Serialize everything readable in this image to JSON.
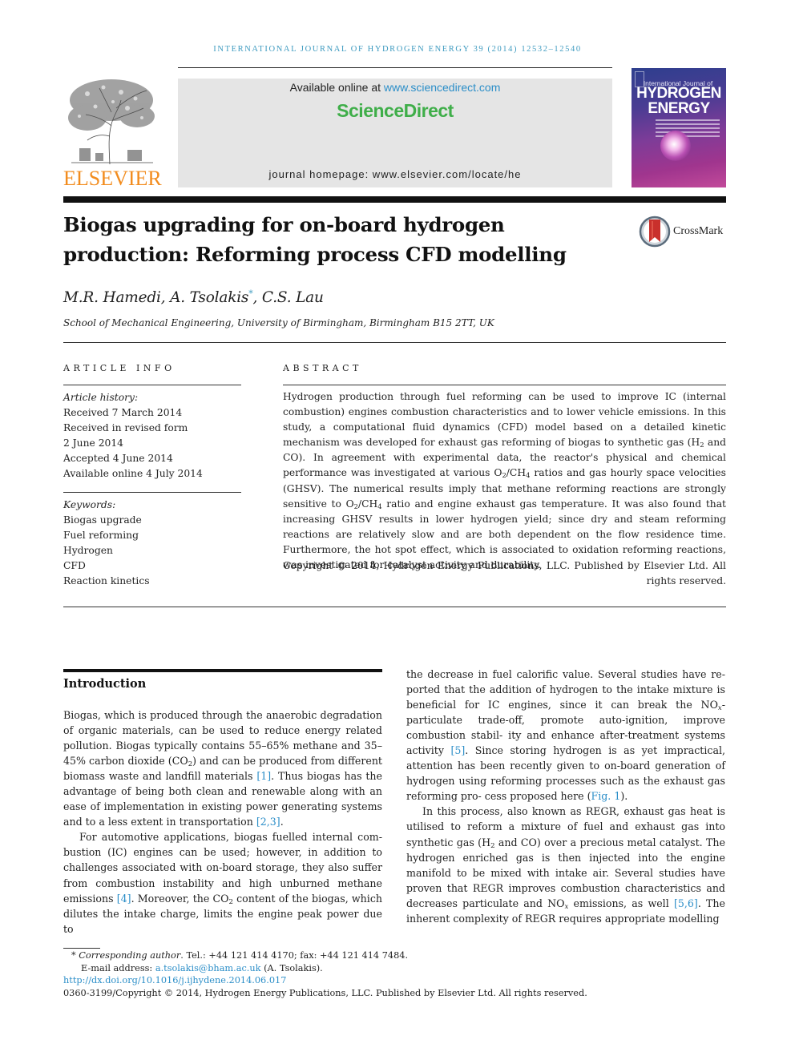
{
  "journal_running_head": "International Journal of Hydrogen Energy 39 (2014) 12532–12540",
  "masthead": {
    "publisher_logo_text": "ELSEVIER",
    "available_online_prefix": "Available online at ",
    "available_online_link": "www.sciencedirect.com",
    "brand": "ScienceDirect",
    "homepage": "journal homepage: www.elsevier.com/locate/he",
    "cover": {
      "line1": "International Journal of",
      "line2": "HYDROGEN",
      "line3": "ENERGY"
    },
    "colors": {
      "elsevier_orange": "#f28c1e",
      "sciencedirect_green": "#3fae49",
      "link_blue": "#2b8ec8",
      "running_head_blue": "#3f9bc0",
      "masthead_box_gray": "#e5e5e5"
    }
  },
  "article": {
    "title_line1": "Biogas upgrading for on-board hydrogen",
    "title_line2": "production: Reforming process CFD modelling",
    "crossmark_label": "CrossMark",
    "authors": [
      {
        "name": "M.R. Hamedi",
        "corresponding": false
      },
      {
        "name": "A. Tsolakis",
        "corresponding": true
      },
      {
        "name": "C.S. Lau",
        "corresponding": false
      }
    ],
    "author_sep": ", ",
    "corresponding_mark": "*",
    "affiliation": "School of Mechanical Engineering, University of Birmingham, Birmingham B15 2TT, UK"
  },
  "article_info": {
    "label": "ARTICLE INFO",
    "history_heading": "Article history:",
    "history": [
      "Received 7 March 2014",
      "Received in revised form",
      "2 June 2014",
      "Accepted 4 June 2014",
      "Available online 4 July 2014"
    ],
    "keywords_heading": "Keywords:",
    "keywords": [
      "Biogas upgrade",
      "Fuel reforming",
      "Hydrogen",
      "CFD",
      "Reaction kinetics"
    ]
  },
  "abstract": {
    "label": "ABSTRACT",
    "s1": "Hydrogen production through fuel reforming can be used to improve IC (internal combustion) engines combustion characteristics and to lower vehicle emissions. In this study, a computational fluid dynamics (CFD) model based on a detailed kinetic mechanism was developed for exhaust gas reforming of biogas to synthetic gas (H",
    "s1_sub": "2",
    "s2": " and CO). In agreement with experimental data, the reactor's physical and chemical performance was investigated at various O",
    "s2_sub1": "2",
    "s2_mid": "/CH",
    "s2_sub2": "4",
    "s3": " ratios and gas hourly space velocities (GHSV). The numerical results imply that methane reforming reactions are strongly sensitive to O",
    "s3_sub1": "2",
    "s3_mid": "/CH",
    "s3_sub2": "4",
    "s4": " ratio and engine exhaust gas temperature. It was also found that increasing GHSV results in lower hydrogen yield; since dry and steam reforming reactions are relatively slow and are both dependent on the flow residence time. Furthermore, the hot spot effect, which is associated to oxidation reforming reactions, was investigated for catalyst activity and durability.",
    "copyright": "Copyright © 2014, Hydrogen Energy Publications, LLC. Published by Elsevier Ltd. All rights reserved."
  },
  "introduction": {
    "heading": "Introduction",
    "left": {
      "p1_a": "Biogas, which is produced through the anaerobic degradation of organic materials, can be used to reduce energy related pollution. Biogas typically contains 55–65% methane and 35–45% carbon dioxide (CO",
      "p1_sub": "2",
      "p1_b": ") and can be produced from different biomass waste and landfill materials ",
      "p1_ref1": "[1]",
      "p1_c": ". Thus biogas has the advantage of being both clean and renewable along with an ease of implementation in existing power generating systems and to a less extent in transportation ",
      "p1_ref2": "[2,3]",
      "p1_d": ".",
      "p2_a": "For automotive applications, biogas fuelled internal com- bustion (IC) engines can be used; however, in addition to challenges associated with on-board storage, they also suffer from combustion instability and high unburned methane emissions ",
      "p2_ref1": "[4]",
      "p2_b": ". Moreover, the CO",
      "p2_sub": "2",
      "p2_c": " content of the biogas, which dilutes the intake charge, limits the engine peak power due to"
    },
    "right": {
      "p1_a": "the decrease in fuel calorific value. Several studies have re- ported that the addition of hydrogen to the intake mixture is beneficial for IC engines, since it can break the NO",
      "p1_sub": "x",
      "p1_b": "-particulate trade-off, promote auto-ignition, improve combustion stabil- ity and enhance after-treatment systems activity ",
      "p1_ref1": "[5]",
      "p1_c": ". Since storing hydrogen is as yet impractical, attention has been recently given to on-board generation of hydrogen using reforming processes such as the exhaust gas reforming pro- cess proposed here (",
      "p1_ref2": "Fig. 1",
      "p1_d": ").",
      "p2_a": "In this process, also known as REGR, exhaust gas heat is utilised to reform a mixture of fuel and exhaust gas into synthetic gas (H",
      "p2_sub1": "2",
      "p2_b": " and CO) over a precious metal catalyst. The hydrogen enriched gas is then injected into the engine manifold to be mixed with intake air. Several studies have proven that REGR improves combustion characteristics and decreases particulate and NO",
      "p2_sub2": "x",
      "p2_c": " emissions, as well ",
      "p2_ref1": "[5,6]",
      "p2_d": ". The inherent complexity of REGR requires appropriate modelling"
    }
  },
  "footnotes": {
    "star": "* ",
    "corresponding_label": "Corresponding author",
    "contact": ". Tel.: +44 121 414 4170; fax: +44 121 414 7484.",
    "email_label": "E-mail address: ",
    "email": "a.tsolakis@bham.ac.uk",
    "email_suffix": " (A. Tsolakis).",
    "doi": "http://dx.doi.org/10.1016/j.ijhydene.2014.06.017",
    "issn_copyright": "0360-3199/Copyright © 2014, Hydrogen Energy Publications, LLC. Published by Elsevier Ltd. All rights reserved."
  }
}
